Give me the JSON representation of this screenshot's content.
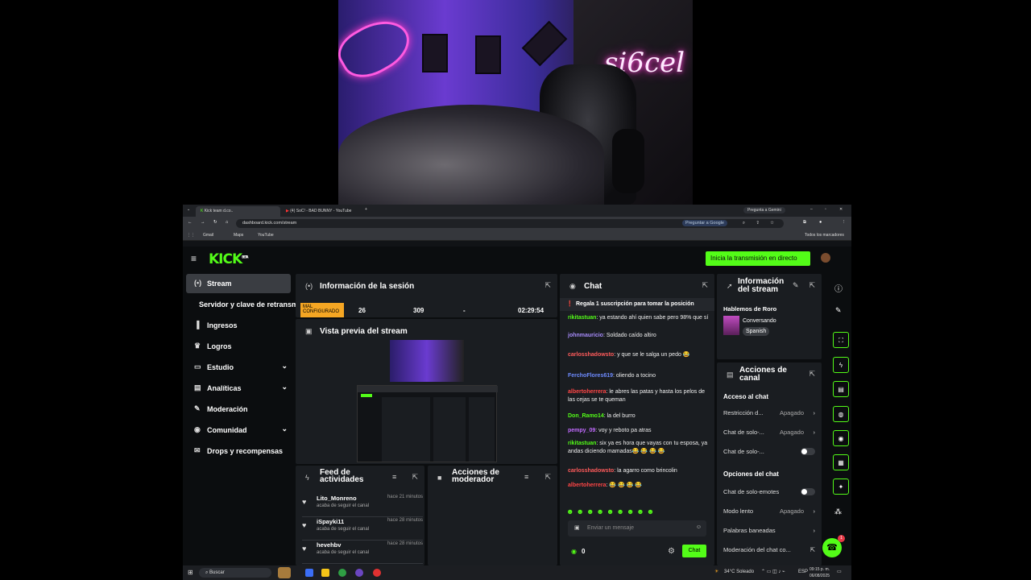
{
  "browser": {
    "tabs": [
      {
        "label": "Kick team d.co..",
        "active": true
      },
      {
        "label": "(4) SoC! - BAD BUNNY - YouTube",
        "active": false
      }
    ],
    "gemini": "Pregunta a Gemini",
    "url": "dashboard.kick.com/stream",
    "google_btn": "Preguntar a Google",
    "bookmarks": [
      "Gmail",
      "Maps",
      "YouTube"
    ],
    "all_bookmarks": "Todos los marcadores"
  },
  "kick": {
    "logo": "KICK",
    "logo_sup": "BETA",
    "golive": "Inicia la transmisión en directo",
    "sidebar": [
      {
        "label": "Stream",
        "icon": "broadcast-icon",
        "selected": true,
        "chevron": false
      },
      {
        "label": "Servidor y clave de retransmisión",
        "icon": "",
        "selected": false,
        "chevron": false
      },
      {
        "label": "Ingresos",
        "icon": "bar-chart-icon",
        "selected": false,
        "chevron": false
      },
      {
        "label": "Logros",
        "icon": "trophy-icon",
        "selected": false,
        "chevron": false
      },
      {
        "label": "Estudio",
        "icon": "studio-icon",
        "selected": false,
        "chevron": true
      },
      {
        "label": "Analíticas",
        "icon": "analytics-icon",
        "selected": false,
        "chevron": true
      },
      {
        "label": "Moderación",
        "icon": "wrench-icon",
        "selected": false,
        "chevron": false
      },
      {
        "label": "Comunidad",
        "icon": "community-icon",
        "selected": false,
        "chevron": true
      },
      {
        "label": "Drops y recompensas",
        "icon": "gift-icon",
        "selected": false,
        "chevron": false
      }
    ],
    "session": {
      "title": "Información de la sesión",
      "status": "MAL CONFIGURADO",
      "values": [
        "26",
        "309",
        "-",
        "02:29:54"
      ]
    },
    "preview": {
      "title": "Vista previa del stream"
    },
    "feed": {
      "title": "Feed de actividades",
      "items": [
        {
          "name": "Lito_Monreno",
          "time": "hace 21 minutos",
          "action": "acaba de seguir el canal"
        },
        {
          "name": "iSpayki11",
          "time": "hace 28 minutos",
          "action": "acaba de seguir el canal"
        },
        {
          "name": "hevehbv",
          "time": "hace 28 minutos",
          "action": "acaba de seguir el canal"
        }
      ]
    },
    "modactions": {
      "title": "Acciones de moderador"
    },
    "chat": {
      "title": "Chat",
      "pinned": "Regala 1 suscripción para tomar la posición",
      "messages": [
        {
          "user": "rikitastuan",
          "color": "#53fc18",
          "text": "ya estando ahí quien sabe pero 98% que sí"
        },
        {
          "user": "johnmauricio",
          "color": "#a78bfa",
          "text": "Soldado caído altiro"
        },
        {
          "user": "carlosshadowsto",
          "color": "#ff5b5b",
          "text": "y que se le salga un pedo 😂"
        },
        {
          "user": "FerchoFlores619",
          "color": "#6e8bff",
          "text": "oliendo a tocino"
        },
        {
          "user": "albertoherrera",
          "color": "#ff4646",
          "text": "le abres las patas y hasta los pelos de las cejas se te queman"
        },
        {
          "user": "Don_Ramo14",
          "color": "#53fc18",
          "text": "la del burro"
        },
        {
          "user": "pempy_09",
          "color": "#c26bff",
          "text": "voy y reboto pa atras"
        },
        {
          "user": "rikitastuan",
          "color": "#53fc18",
          "text": "six ya es hora que vayas con tu esposa, ya andas diciendo mamadas😂 😂 😂 😂"
        },
        {
          "user": "carlosshadowsto",
          "color": "#ff5b5b",
          "text": "la agarro como brincolin"
        },
        {
          "user": "albertoherrera",
          "color": "#ff4646",
          "text": "😂 😂 😂 😂"
        }
      ],
      "placeholder": "Enviar un mensaje",
      "count": "0",
      "send": "Chat"
    },
    "streaminfo": {
      "title": "Información del stream",
      "stream_title": "Hablemos de Roro",
      "category": "Conversando",
      "language": "Spanish"
    },
    "channel": {
      "title": "Acciones de canal",
      "access_heading": "Acceso al chat",
      "access_rows": [
        {
          "label": "Restricción d...",
          "value": "Apagado"
        },
        {
          "label": "Chat de solo-...",
          "value": "Apagado"
        },
        {
          "label": "Chat de solo-...",
          "value": ""
        }
      ],
      "options_heading": "Opciones del chat",
      "option_rows": [
        {
          "label": "Chat de solo-emotes",
          "value": ""
        },
        {
          "label": "Modo lento",
          "value": "Apagado"
        },
        {
          "label": "Palabras baneadas",
          "value": ""
        },
        {
          "label": "Moderación del chat co...",
          "value": ""
        }
      ]
    },
    "badge": "1"
  },
  "taskbar": {
    "search": "Buscar",
    "weather": "34°C Soleado",
    "lang": "ESP",
    "time": "09:15 p. m.",
    "date": "06/08/2025"
  },
  "colors": {
    "accent": "#53fc18",
    "bg": "#0b0d0f",
    "panel": "#1a1d21"
  }
}
